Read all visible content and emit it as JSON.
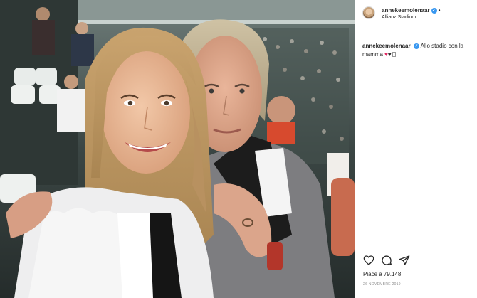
{
  "post": {
    "username": "annekeemolenaar",
    "verified_mark": "✓",
    "separator": "•",
    "location": "Allianz Stadium",
    "caption": {
      "username": "annekeemolenaar",
      "text": "Allo stadio con la mamma",
      "emoji_1": "♥",
      "emoji_2": "♥"
    },
    "likes_text": "Piace a 79.148",
    "date": "26 NOVEMBRE 2019"
  },
  "icons": {
    "like": "heart-outline-icon",
    "comment": "comment-bubble-icon",
    "share": "paper-plane-icon",
    "verified": "verified-badge-icon"
  },
  "colors": {
    "verified_blue": "#3897f0",
    "heart_red": "#e0245e",
    "text": "#262626",
    "muted": "#8e8e8e"
  }
}
